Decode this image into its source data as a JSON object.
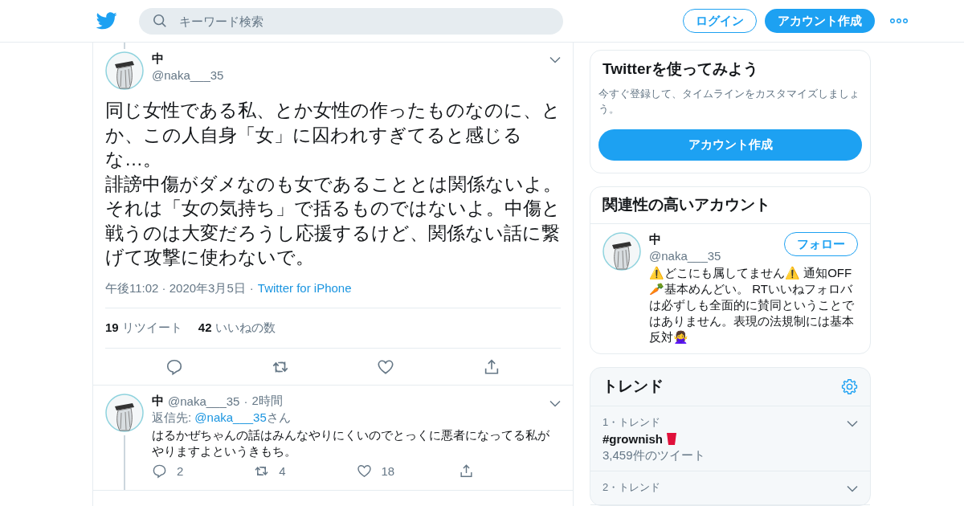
{
  "header": {
    "search": {
      "placeholder": "キーワード検索"
    },
    "login": "ログイン",
    "signup": "アカウント作成"
  },
  "tweet": {
    "name": "中",
    "handle": "@naka___35",
    "paragraphs": [
      "同じ女性である私、とか女性の作ったものなのに、とか、この人自身「女」に囚われすぎてると感じるな…。",
      "誹謗中傷がダメなのも女であることとは関係ないよ。それは「女の気持ち」で括るものではないよ。中傷と戦うのは大変だろうし応援するけど、関係ない話に繋げて攻撃に使わないで。"
    ],
    "time": "午後11:02 · 2020年3月5日",
    "separator": "·",
    "source": "Twitter for iPhone",
    "stats": [
      {
        "count": "19",
        "label": "リツイート"
      },
      {
        "count": "42",
        "label": "いいねの数"
      }
    ]
  },
  "replies": [
    {
      "name": "中",
      "handle": "@naka___35",
      "separator": "·",
      "time": "2時間",
      "reply_label": "返信先:",
      "reply_to": "@naka___35",
      "reply_suffix": "さん",
      "text": "はるかぜちゃんの話はみんなやりにくいのでとっくに悪者になってる私がやりますよというきもち。",
      "reply_count": "2",
      "retweet_count": "4",
      "like_count": "18"
    }
  ],
  "signup_card": {
    "title": "Twitterを使ってみよう",
    "description": "今すぐ登録して、タイムラインをカスタマイズしましょう。",
    "button": "アカウント作成"
  },
  "related": {
    "title": "関連性の高いアカウント",
    "accounts": [
      {
        "name": "中",
        "handle": "@naka___35",
        "follow": "フォロー",
        "bio": "⚠️どこにも属してません⚠️ 通知OFF🥕基本めんどい。 RTいいねフォロバは必ずしも全面的に賛同ということではありません。表現の法規制には基本反対🙅‍♀️"
      }
    ]
  },
  "trends": {
    "title": "トレンド",
    "items": [
      {
        "rank": "1・トレンド",
        "name": "#grownish",
        "has_cup": true,
        "count": "3,459件のツイート"
      },
      {
        "rank": "2・トレンド"
      }
    ]
  }
}
